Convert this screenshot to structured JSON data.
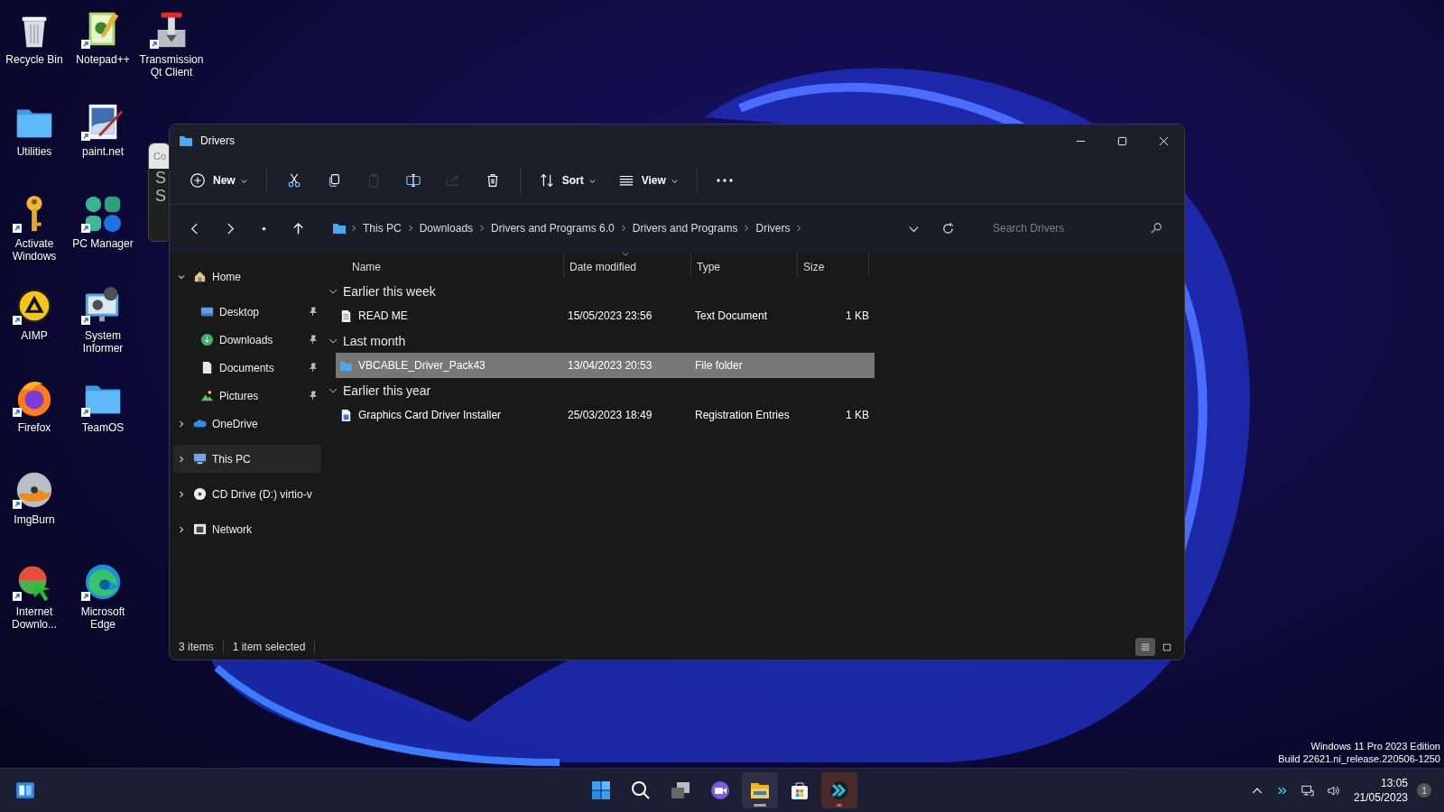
{
  "desktop": {
    "rows": [
      [
        {
          "label": "Recycle Bin",
          "kind": "recycle",
          "shortcut": false
        },
        {
          "label": "Notepad++",
          "kind": "notepad",
          "shortcut": true
        },
        {
          "label": "Transmission Qt Client",
          "kind": "transmission",
          "shortcut": true
        }
      ],
      [
        {
          "label": "Utilities",
          "kind": "folder",
          "shortcut": false
        },
        {
          "label": "paint.net",
          "kind": "paint",
          "shortcut": true
        }
      ],
      [
        {
          "label": "Activate Windows",
          "kind": "key",
          "shortcut": true
        },
        {
          "label": "PC Manager",
          "kind": "pcmanager",
          "shortcut": true
        }
      ],
      [
        {
          "label": "AIMP",
          "kind": "aimp",
          "shortcut": true
        },
        {
          "label": "System Informer",
          "kind": "sysinformer",
          "shortcut": true
        }
      ],
      [
        {
          "label": "Firefox",
          "kind": "firefox",
          "shortcut": true
        },
        {
          "label": "TeamOS",
          "kind": "folder",
          "shortcut": true
        }
      ],
      [
        {
          "label": "ImgBurn",
          "kind": "disc",
          "shortcut": true
        }
      ],
      [
        {
          "label": "Internet Downlo...",
          "kind": "idm",
          "shortcut": true
        },
        {
          "label": "Microsoft Edge",
          "kind": "edge",
          "shortcut": true
        }
      ]
    ],
    "watermark": [
      "Windows 11 Pro 2023 Edition",
      "Build 22621.ni_release.220506-1250"
    ]
  },
  "behind_window": {
    "title": "Co",
    "lines": [
      "S",
      "S"
    ]
  },
  "window": {
    "title": "Drivers",
    "toolbar": {
      "groups": [
        [
          {
            "kind": "new",
            "label": "New",
            "disabled": false
          }
        ],
        [
          {
            "kind": "cut",
            "disabled": false
          },
          {
            "kind": "copy",
            "disabled": false
          },
          {
            "kind": "paste",
            "disabled": true
          },
          {
            "kind": "rename",
            "disabled": false
          },
          {
            "kind": "share",
            "disabled": true
          },
          {
            "kind": "delete",
            "disabled": false
          }
        ],
        [
          {
            "kind": "sort",
            "label": "Sort",
            "disabled": false
          },
          {
            "kind": "view",
            "label": "View",
            "disabled": false
          }
        ],
        [
          {
            "kind": "more",
            "disabled": false
          }
        ]
      ]
    },
    "breadcrumb": [
      "This PC",
      "Downloads",
      "Drivers and Programs 6.0",
      "Drivers and Programs",
      "Drivers"
    ],
    "search": {
      "placeholder": "Search Drivers"
    },
    "sidebar": {
      "items": [
        {
          "label": "Home",
          "kind": "home",
          "expanded": true,
          "selected": false,
          "children": [
            {
              "label": "Desktop",
              "kind": "desktop",
              "pinned": true,
              "selected": false
            },
            {
              "label": "Downloads",
              "kind": "downloads",
              "pinned": true,
              "selected": false
            },
            {
              "label": "Documents",
              "kind": "documents",
              "pinned": true,
              "selected": false
            },
            {
              "label": "Pictures",
              "kind": "pictures",
              "pinned": true,
              "selected": false
            }
          ]
        },
        {
          "label": "OneDrive",
          "kind": "cloud",
          "expanded": false,
          "selected": false
        },
        {
          "label": "This PC",
          "kind": "pc",
          "expanded": false,
          "selected": true
        },
        {
          "label": "CD Drive (D:) virtio-v",
          "kind": "cd",
          "expanded": false,
          "selected": false
        },
        {
          "label": "Network",
          "kind": "network",
          "expanded": false,
          "selected": false
        }
      ]
    },
    "table": {
      "columns": [
        {
          "label": "Name",
          "sorted": false
        },
        {
          "label": "Date modified",
          "sorted": true
        },
        {
          "label": "Type",
          "sorted": false
        },
        {
          "label": "Size",
          "sorted": false
        }
      ],
      "groups": [
        {
          "label": "Earlier this week",
          "expanded": true,
          "rows": [
            {
              "name": "READ ME",
              "kind": "text",
              "date": "15/05/2023 23:56",
              "type": "Text Document",
              "size": "1 KB",
              "selected": false
            }
          ]
        },
        {
          "label": "Last month",
          "expanded": true,
          "rows": [
            {
              "name": "VBCABLE_Driver_Pack43",
              "kind": "folder",
              "date": "13/04/2023 20:53",
              "type": "File folder",
              "size": "",
              "selected": true
            }
          ]
        },
        {
          "label": "Earlier this year",
          "expanded": true,
          "rows": [
            {
              "name": "Graphics Card Driver Installer",
              "kind": "reg",
              "date": "25/03/2023 18:49",
              "type": "Registration Entries",
              "size": "1 KB",
              "selected": false
            }
          ]
        }
      ]
    },
    "status_bar": {
      "item_count": "3 items",
      "selection": "1 item selected",
      "views": [
        {
          "kind": "details",
          "selected": true
        },
        {
          "kind": "tiles",
          "selected": false
        }
      ]
    }
  },
  "taskbar": {
    "apps": [
      {
        "kind": "start",
        "running": false,
        "attention": false
      },
      {
        "kind": "search",
        "running": false,
        "attention": false
      },
      {
        "kind": "taskview",
        "running": false,
        "attention": false
      },
      {
        "kind": "chat",
        "running": false,
        "attention": false
      },
      {
        "kind": "explorer",
        "running": true,
        "attention": false
      },
      {
        "kind": "store",
        "running": false,
        "attention": false
      },
      {
        "kind": "arrowapp",
        "running": true,
        "attention": true
      }
    ],
    "time": "13:05",
    "date": "21/05/2023",
    "notifications": "1"
  }
}
